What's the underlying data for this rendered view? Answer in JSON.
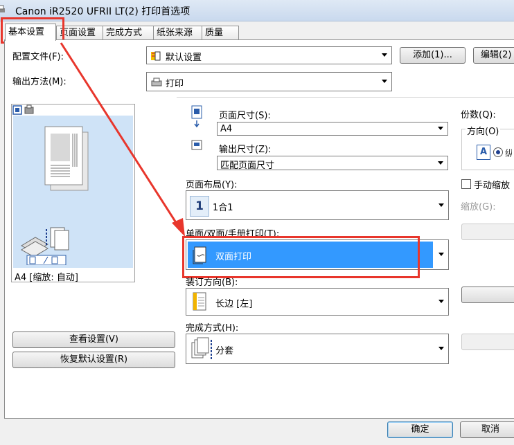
{
  "window": {
    "title": "Canon iR2520 UFRII LT(2) 打印首选项"
  },
  "tabs": [
    "基本设置",
    "页面设置",
    "完成方式",
    "纸张来源",
    "质量"
  ],
  "profile": {
    "label": "配置文件(F):",
    "value": "默认设置",
    "add_button": "添加(1)...",
    "edit_button": "编辑(2)"
  },
  "output": {
    "label": "输出方法(M):",
    "value": "打印"
  },
  "preview": {
    "status": "A4 [缩放: 自动]"
  },
  "page_size": {
    "label": "页面尺寸(S):",
    "value": "A4"
  },
  "output_size": {
    "label": "输出尺寸(Z):",
    "value": "匹配页面尺寸"
  },
  "page_layout": {
    "label": "页面布局(Y):",
    "value": "1合1",
    "icon_number": "1"
  },
  "duplex": {
    "label": "单面/双面/手册打印(T):",
    "value": "双面打印"
  },
  "binding": {
    "label": "装订方向(B):",
    "value": "长边 [左]"
  },
  "finishing": {
    "label": "完成方式(H):",
    "value": "分套"
  },
  "copies": {
    "label": "份数(Q):"
  },
  "orientation": {
    "label": "方向(O)",
    "letter": "A"
  },
  "manual_scaling": {
    "label": "手动缩放"
  },
  "scaling": {
    "label": "缩放(G):"
  },
  "view_settings_button": "查看设置(V)",
  "restore_defaults_button": "恢复默认设置(R)",
  "ok_button": "确定",
  "cancel_button": "取消",
  "colors": {
    "accent": "#3399ff",
    "annotation_red": "#e8362c",
    "preview_bg": "#cfe3f7"
  }
}
